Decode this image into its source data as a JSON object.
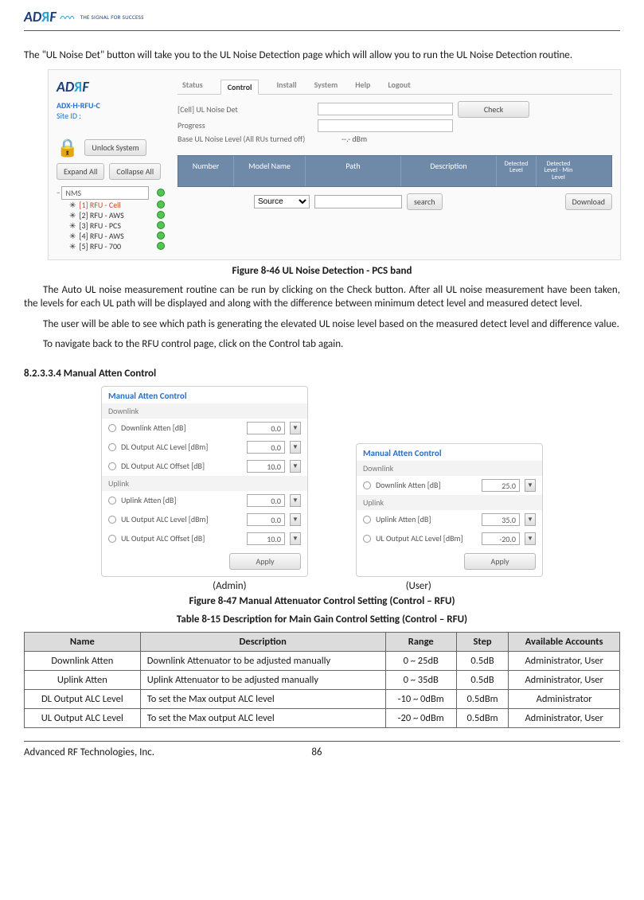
{
  "header": {
    "logo_ad": "AD",
    "logo_r": "R",
    "logo_f": "F",
    "tagline": "THE SIGNAL FOR SUCCESS"
  },
  "intro": "The \"UL Noise Det\" button will take you to the UL Noise Detection page which will allow you to run the UL Noise Detection routine.",
  "screenshot1": {
    "model": "ADX-H-RFU-C",
    "site_label": "Site ID :",
    "unlock": "Unlock System",
    "expand": "Expand All",
    "collapse": "Collapse All",
    "tree_root": "NMS",
    "tree_items": [
      {
        "label": "[1] RFU - Cell",
        "color": "#c94a2b"
      },
      {
        "label": "[2] RFU - AWS",
        "color": "#333"
      },
      {
        "label": "[3] RFU - PCS",
        "color": "#333"
      },
      {
        "label": "[4] RFU - AWS",
        "color": "#333"
      },
      {
        "label": "[5] RFU - 700",
        "color": "#333"
      }
    ],
    "tabs": [
      "Status",
      "Control",
      "Install",
      "System",
      "Help",
      "Logout"
    ],
    "active_tab_index": 1,
    "field1_label": "[Cell] UL Noise Det",
    "check_btn": "Check",
    "field2_label": "Progress",
    "field3_label": "Base UL Noise Level (All RUs turned off)",
    "field3_value": "--.- dBm",
    "headers": [
      "Number",
      "Model Name",
      "Path",
      "Description",
      "Detected Level",
      "Detected Level - Min Level"
    ],
    "source_label": "Source",
    "search_btn": "search",
    "download_btn": "Download"
  },
  "fig1_caption": "Figure 8-46    UL Noise Detection - PCS band",
  "para1": "The Auto UL noise measurement routine can be run by clicking on the Check button.  After all UL noise measurement have been taken, the levels for each UL path will be displayed and along with the difference between minimum detect level and measured detect level.",
  "para2": "The user will be able to see which path is generating the elevated UL noise level based on the measured detect level and difference value.",
  "para3": "To navigate back to the RFU control page, click on the Control tab again.",
  "section_heading": "8.2.3.3.4    Manual Atten Control",
  "panel_a": {
    "title": "Manual Atten Control",
    "sub1": "Downlink",
    "rows1": [
      {
        "label": "Downlink Atten [dB]",
        "val": "0.0"
      },
      {
        "label": "DL Output ALC Level [dBm]",
        "val": "0.0"
      },
      {
        "label": "DL Output ALC Offset [dB]",
        "val": "10.0"
      }
    ],
    "sub2": "Uplink",
    "rows2": [
      {
        "label": "Uplink Atten [dB]",
        "val": "0.0"
      },
      {
        "label": "UL Output ALC Level [dBm]",
        "val": "0.0"
      },
      {
        "label": "UL Output ALC Offset [dB]",
        "val": "10.0"
      }
    ],
    "apply": "Apply",
    "caption": "(Admin)"
  },
  "panel_b": {
    "title": "Manual Atten Control",
    "sub1": "Downlink",
    "rows1": [
      {
        "label": "Downlink Atten [dB]",
        "val": "25.0"
      }
    ],
    "sub2": "Uplink",
    "rows2": [
      {
        "label": "Uplink Atten [dB]",
        "val": "35.0"
      },
      {
        "label": "UL Output ALC Level [dBm]",
        "val": "-20.0"
      }
    ],
    "apply": "Apply",
    "caption": "(User)"
  },
  "fig2_caption": "Figure 8-47    Manual Attenuator Control Setting (Control – RFU)",
  "table_caption": "Table 8-15     Description for Main Gain Control Setting (Control – RFU)",
  "table": {
    "headers": [
      "Name",
      "Description",
      "Range",
      "Step",
      "Available Accounts"
    ],
    "rows": [
      [
        "Downlink Atten",
        "Downlink Attenuator to be adjusted manually",
        "0 ~ 25dB",
        "0.5dB",
        "Administrator, User"
      ],
      [
        "Uplink Atten",
        "Uplink Attenuator to be adjusted manually",
        "0 ~ 35dB",
        "0.5dB",
        "Administrator, User"
      ],
      [
        "DL Output ALC Level",
        "To set the Max output ALC level",
        "-10 ~ 0dBm",
        "0.5dBm",
        "Administrator"
      ],
      [
        "UL Output ALC Level",
        "To set the Max output ALC level",
        "-20 ~ 0dBm",
        "0.5dBm",
        "Administrator, User"
      ]
    ]
  },
  "footer": {
    "company": "Advanced RF Technologies, Inc.",
    "page": "86"
  }
}
